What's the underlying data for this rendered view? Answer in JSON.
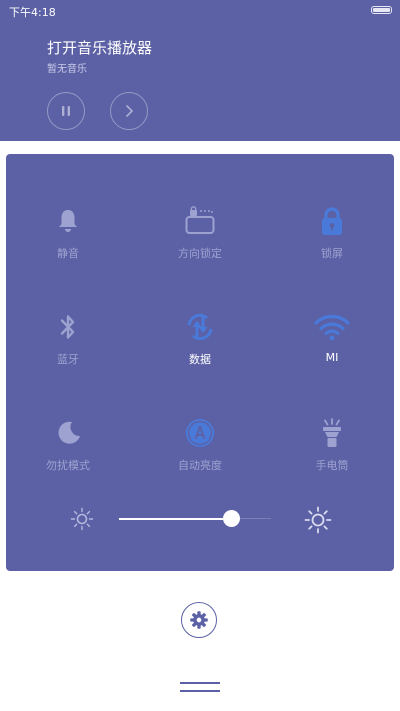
{
  "status_bar": {
    "time": "下午4:18"
  },
  "music": {
    "title": "打开音乐播放器",
    "subtitle": "暂无音乐"
  },
  "toggles": [
    {
      "label": "静音",
      "icon": "bell-icon",
      "active": false
    },
    {
      "label": "方向锁定",
      "icon": "rotation-lock-icon",
      "active": false
    },
    {
      "label": "锁屏",
      "icon": "lock-icon",
      "active": false
    },
    {
      "label": "蓝牙",
      "icon": "bluetooth-icon",
      "active": false
    },
    {
      "label": "数据",
      "icon": "data-icon",
      "active": true
    },
    {
      "label": "MI",
      "icon": "wifi-icon",
      "active": true
    },
    {
      "label": "勿扰模式",
      "icon": "moon-icon",
      "active": false
    },
    {
      "label": "自动亮度",
      "icon": "auto-brightness-icon",
      "active": false
    },
    {
      "label": "手电筒",
      "icon": "flashlight-icon",
      "active": false
    }
  ],
  "brightness": {
    "level": 0.74
  },
  "colors": {
    "panel": "#5c61a6",
    "active_icon": "#4a7ad9",
    "inactive": "#9ea2d0"
  }
}
